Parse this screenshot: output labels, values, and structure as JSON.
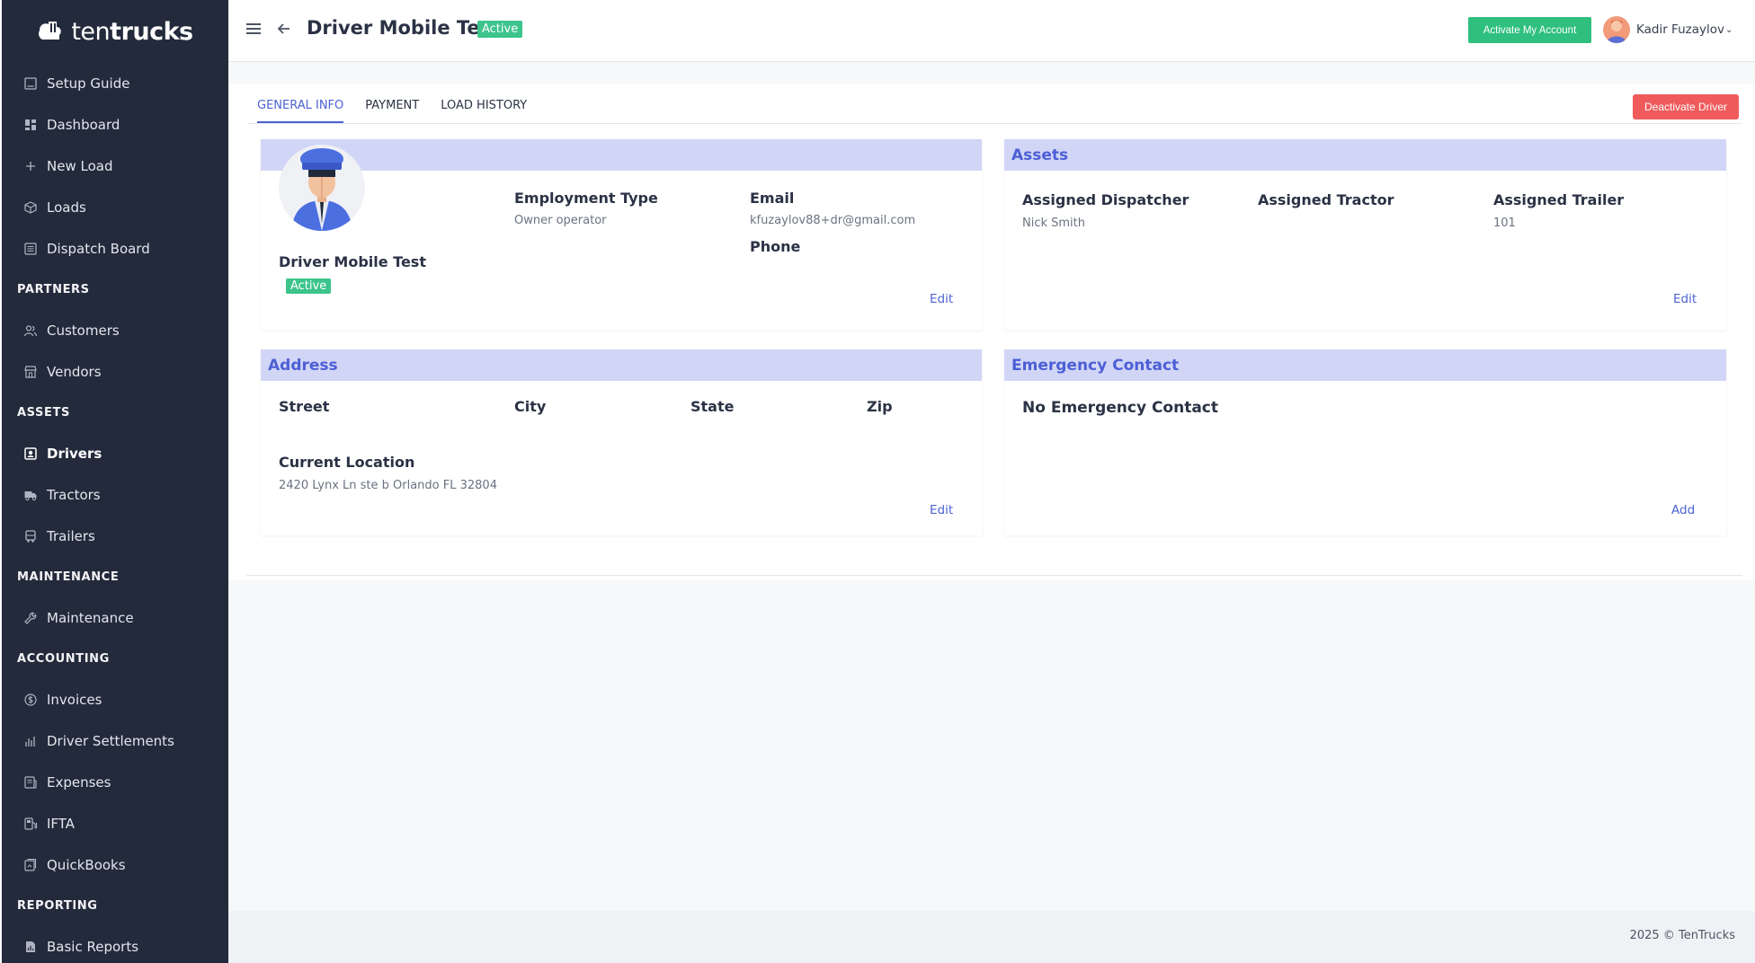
{
  "brand": {
    "name_light": "ten",
    "name_bold": "trucks"
  },
  "sidebar": {
    "items": [
      {
        "label": "Setup Guide",
        "icon": "book-icon"
      },
      {
        "label": "Dashboard",
        "icon": "dashboard-icon"
      },
      {
        "label": "New Load",
        "icon": "plus-icon"
      },
      {
        "label": "Loads",
        "icon": "box-icon"
      },
      {
        "label": "Dispatch Board",
        "icon": "board-icon"
      }
    ],
    "sections": [
      {
        "title": "PARTNERS",
        "items": [
          {
            "label": "Customers",
            "icon": "users-icon"
          },
          {
            "label": "Vendors",
            "icon": "store-icon"
          }
        ]
      },
      {
        "title": "ASSETS",
        "items": [
          {
            "label": "Drivers",
            "icon": "driver-icon",
            "active": true
          },
          {
            "label": "Tractors",
            "icon": "truck-icon"
          },
          {
            "label": "Trailers",
            "icon": "trailer-icon"
          }
        ]
      },
      {
        "title": "MAINTENANCE",
        "items": [
          {
            "label": "Maintenance",
            "icon": "wrench-icon"
          }
        ]
      },
      {
        "title": "ACCOUNTING",
        "items": [
          {
            "label": "Invoices",
            "icon": "dollar-icon"
          },
          {
            "label": "Driver Settlements",
            "icon": "bars-icon"
          },
          {
            "label": "Expenses",
            "icon": "receipt-icon"
          },
          {
            "label": "IFTA",
            "icon": "fuel-icon"
          },
          {
            "label": "QuickBooks",
            "icon": "ledger-icon"
          }
        ]
      },
      {
        "title": "REPORTING",
        "items": [
          {
            "label": "Basic Reports",
            "icon": "report-icon"
          }
        ]
      }
    ]
  },
  "header": {
    "title": "Driver Mobile Test",
    "status": "Active",
    "activate_label": "Activate My Account",
    "user_name": "Kadir Fuzaylov",
    "user_caret": "⌄"
  },
  "tabs": [
    {
      "label": "GENERAL INFO",
      "active": true
    },
    {
      "label": "PAYMENT",
      "active": false
    },
    {
      "label": "LOAD HISTORY",
      "active": false
    }
  ],
  "deactivate_label": "Deactivate Driver",
  "driver_card": {
    "name": "Driver Mobile Test",
    "status": "Active",
    "employment_type_label": "Employment Type",
    "employment_type": "Owner operator",
    "email_label": "Email",
    "email": "kfuzaylov88+dr@gmail.com",
    "phone_label": "Phone",
    "edit": "Edit"
  },
  "assets_card": {
    "title": "Assets",
    "dispatcher_label": "Assigned Dispatcher",
    "dispatcher": "Nick Smith",
    "tractor_label": "Assigned Tractor",
    "trailer_label": "Assigned Trailer",
    "trailer": "101",
    "edit": "Edit"
  },
  "address_card": {
    "title": "Address",
    "street_label": "Street",
    "city_label": "City",
    "state_label": "State",
    "zip_label": "Zip",
    "location_label": "Current Location",
    "location": "2420 Lynx Ln ste b Orlando FL 32804",
    "edit": "Edit"
  },
  "emergency_card": {
    "title": "Emergency Contact",
    "empty_text": "No Emergency Contact",
    "add": "Add"
  },
  "footer": {
    "text": "2025 © TenTrucks"
  },
  "colors": {
    "sidebar_bg": "#232a3b",
    "accent": "#4c63d2",
    "success": "#3cc48b",
    "danger": "#ef5b5b",
    "card_header": "#d1d5f6"
  }
}
